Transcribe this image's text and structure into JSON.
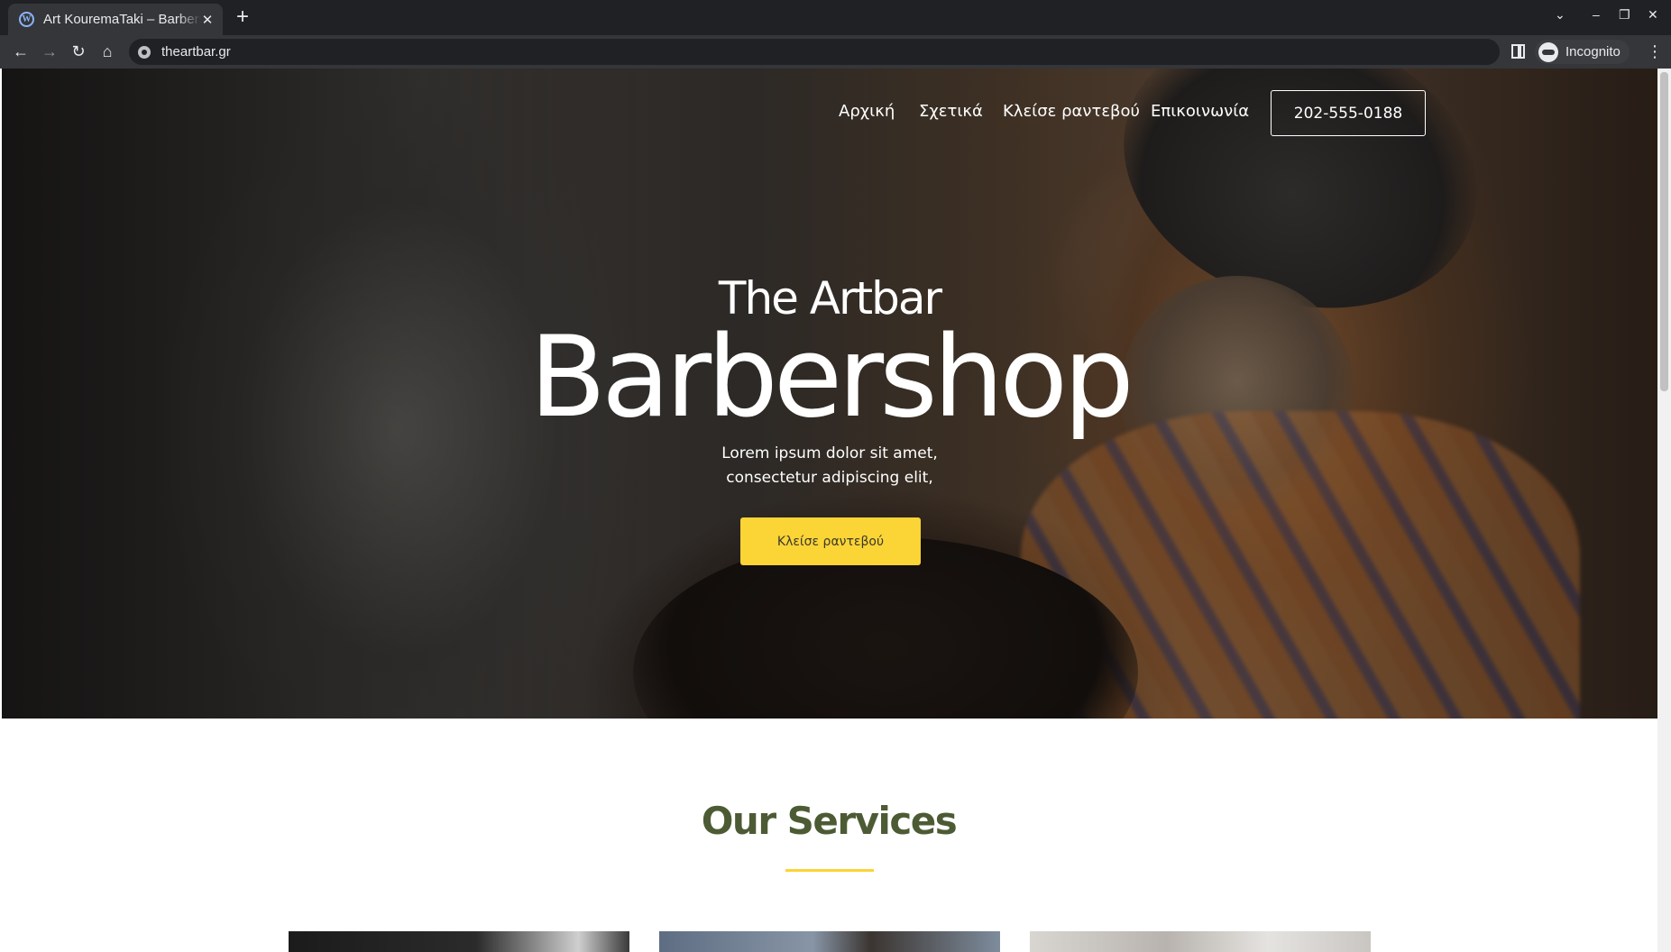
{
  "browser": {
    "tab_title": "Art KouremaTaki – Barbershop",
    "tab_close": "✕",
    "new_tab": "+",
    "url": "theartbar.gr",
    "incognito_label": "Incognito",
    "window_controls": {
      "list": "⌄",
      "minimize": "–",
      "restore": "❐",
      "close": "✕"
    },
    "nav": {
      "back": "←",
      "forward": "→",
      "reload": "↻",
      "home": "⌂",
      "menu": "⋮"
    }
  },
  "hero": {
    "nav": [
      "Αρχική",
      "Σχετικά",
      "Κλείσε ραντεβού",
      "Επικοινωνία"
    ],
    "phone": "202-555-0188",
    "pre_title": "The Artbar",
    "title": "Barbershop",
    "subtitle_line1": "Lorem ipsum dolor sit amet,",
    "subtitle_line2": "consectetur adipiscing elit,",
    "cta": "Κλείσε ραντεβού"
  },
  "services": {
    "title": "Our Services"
  },
  "colors": {
    "accent": "#fbd436",
    "services_title": "#4d5b35",
    "chrome_dark": "#202124",
    "chrome_toolbar": "#35363a"
  }
}
